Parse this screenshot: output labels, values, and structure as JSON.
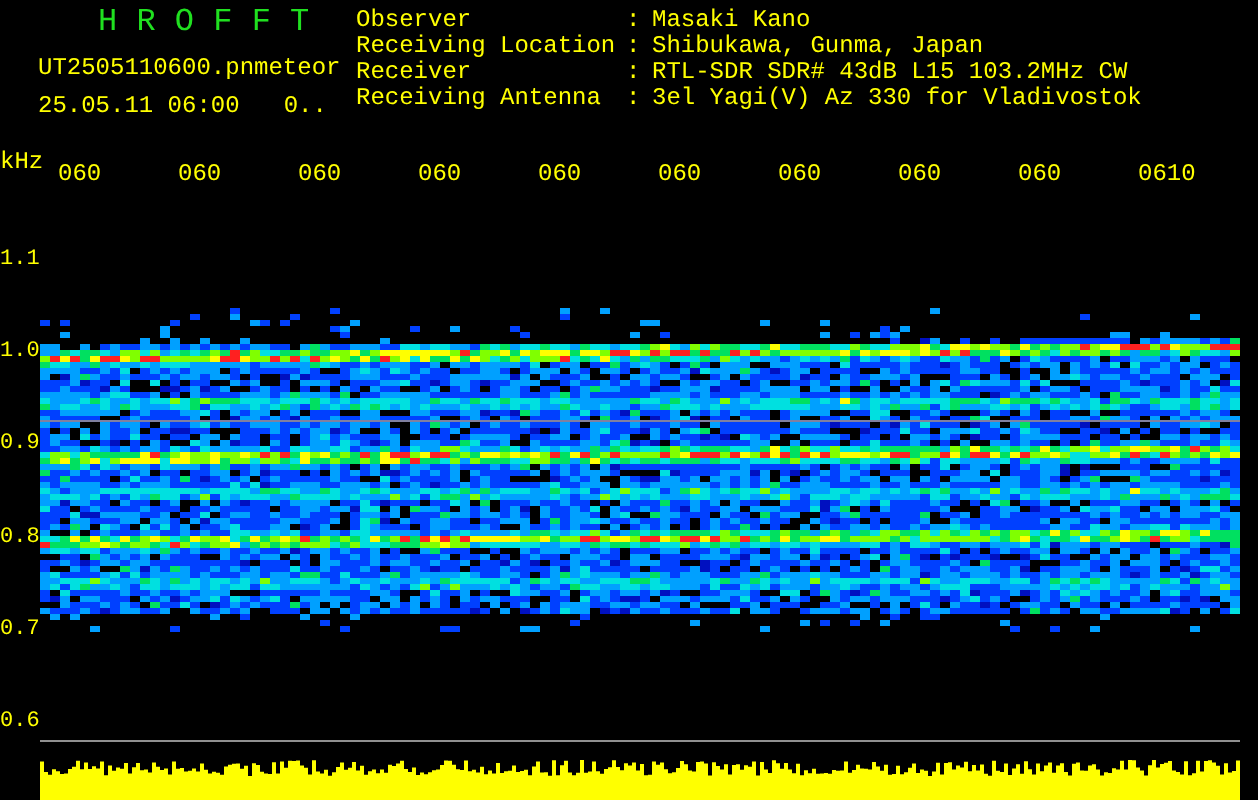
{
  "title": "H R O F F T",
  "file": {
    "name": "UT2505110600.pn",
    "type": "meteor",
    "date": "25.05.11 06:00",
    "value": "0.."
  },
  "info": [
    {
      "label": "Observer",
      "colon": ":",
      "value": "Masaki Kano"
    },
    {
      "label": "Receiving Location",
      "colon": ":",
      "value": "Shibukawa, Gunma, Japan"
    },
    {
      "label": "Receiver",
      "colon": ":",
      "value": "RTL-SDR SDR# 43dB L15 103.2MHz CW"
    },
    {
      "label": "Receiving Antenna",
      "colon": ":",
      "value": "3el Yagi(V) Az 330 for Vladivostok"
    }
  ],
  "unit": "kHz",
  "time_labels": [
    "060",
    "060",
    "060",
    "060",
    "060",
    "060",
    "060",
    "060",
    "060",
    "0610"
  ],
  "freq_labels": [
    "1.1",
    "1.0",
    "0.9",
    "0.8",
    "0.7",
    "0.6"
  ]
}
